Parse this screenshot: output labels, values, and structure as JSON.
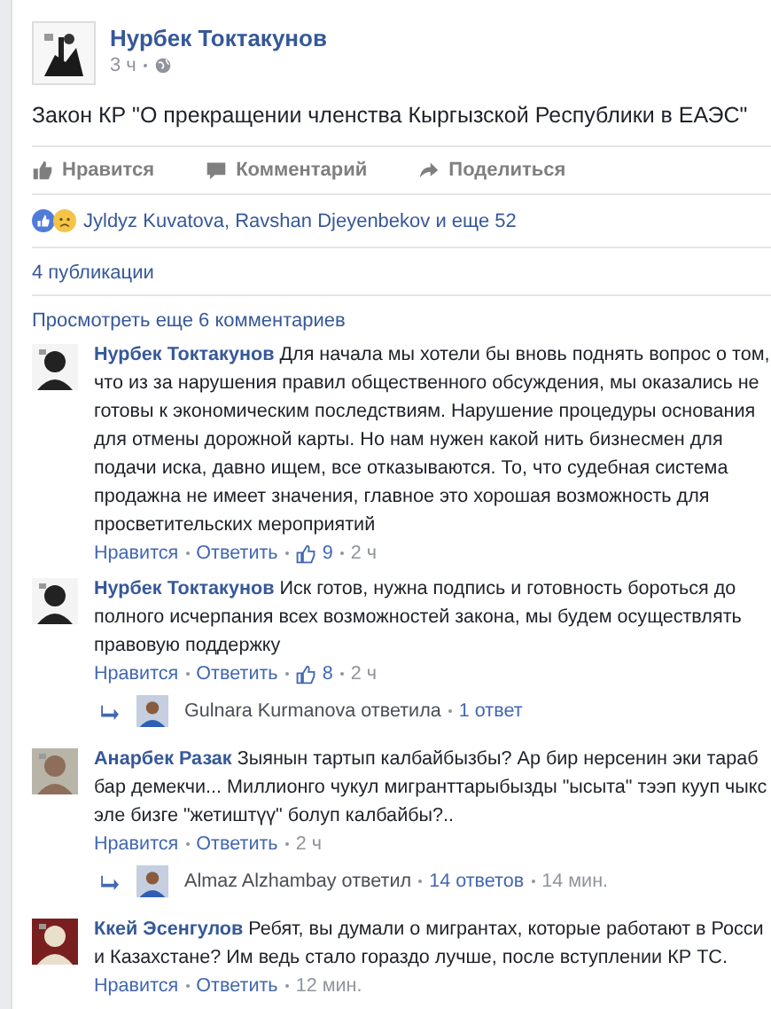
{
  "post": {
    "author": "Нурбек Токтакунов",
    "time": "3 ч",
    "text": "Закон КР \"О прекращении членства Кыргызской Республики в ЕАЭС\"",
    "actions": [
      {
        "kind": "like",
        "label": "Нравится"
      },
      {
        "kind": "comment",
        "label": "Комментарий"
      },
      {
        "kind": "share",
        "label": "Поделиться"
      }
    ],
    "reactions": "Jyldyz Kuvatova, Ravshan Djeyenbekov и еще 52",
    "shares": "4 публикации",
    "more_comments": "Просмотреть еще 6 комментариев",
    "comments": [
      {
        "author": "Нурбек Токтакунов",
        "lines": [
          "Для начала мы хотели бы вновь поднять вопрос о том,",
          "что из за нарушения правил общественного обсуждения, мы оказались не",
          "готовы к экономическим последствиям. Нарушение процедуры основания",
          "для отмены дорожной карты. Но нам нужен какой нить бизнесмен для",
          "подачи иска, давно ищем, все отказываются. То, что судебная система",
          "продажна не имеет значения, главное это хорошая возможность для",
          "просветительских мероприятий"
        ],
        "like": "Нравится",
        "reply": "Ответить",
        "likes": "9",
        "time": "2 ч"
      },
      {
        "author": "Нурбек Токтакунов",
        "lines": [
          "Иск готов, нужна подпись и готовность бороться до",
          "полного исчерпания всех возможностей закона, мы будем осуществлять",
          "правовую поддержку"
        ],
        "like": "Нравится",
        "reply": "Ответить",
        "likes": "8",
        "time": "2 ч",
        "replies": {
          "who": "Gulnara Kurmanova ответила",
          "count": "1 ответ"
        }
      },
      {
        "author": "Анарбек Разак",
        "lines": [
          "Зыянын тартып калбайбызбы? Ар бир нерсенин эки тараб",
          "бар демекчи... Миллионго чукул мигранттарыбызды \"ысыта\" тээп кууп чыкс",
          "эле бизге \"жетиштүү\" болуп калбайбы?.."
        ],
        "like": "Нравится",
        "reply": "Ответить",
        "time": "2 ч",
        "replies": {
          "who": "Almaz Alzhambay ответил",
          "count": "14 ответов",
          "time": "14 мин."
        }
      },
      {
        "author": "Ккей Эсенгулов",
        "lines": [
          "Ребят, вы думали о мигрантах, которые работают в Росси",
          "и Казахстане? Им ведь стало гораздо лучше, после вступлении КР ТС."
        ],
        "like": "Нравится",
        "reply": "Ответить",
        "time": "12 мин."
      }
    ]
  }
}
